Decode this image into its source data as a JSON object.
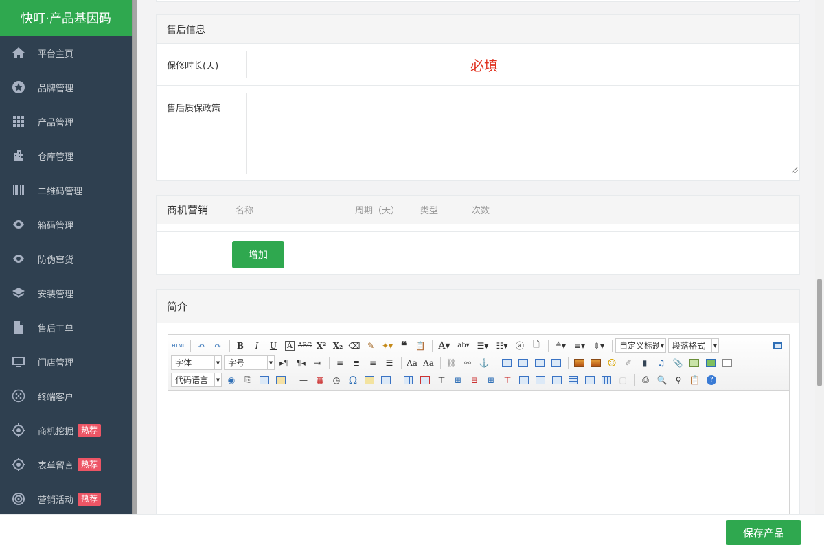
{
  "sidebar": {
    "brand": "快叮·产品基因码",
    "items": [
      {
        "label": "平台主页",
        "icon": "home-icon"
      },
      {
        "label": "品牌管理",
        "icon": "star-icon"
      },
      {
        "label": "产品管理",
        "icon": "grid-icon"
      },
      {
        "label": "仓库管理",
        "icon": "building-icon"
      },
      {
        "label": "二维码管理",
        "icon": "barcode-icon"
      },
      {
        "label": "箱码管理",
        "icon": "eye-icon"
      },
      {
        "label": "防伪窜货",
        "icon": "eye-icon"
      },
      {
        "label": "安装管理",
        "icon": "layers-icon"
      },
      {
        "label": "售后工单",
        "icon": "file-icon"
      },
      {
        "label": "门店管理",
        "icon": "monitor-icon"
      },
      {
        "label": "终端客户",
        "icon": "globe-icon"
      },
      {
        "label": "商机挖掘",
        "icon": "target-icon",
        "badge": "热荐"
      },
      {
        "label": "表单留言",
        "icon": "target-icon",
        "badge": "热荐"
      },
      {
        "label": "营销活动",
        "icon": "broadcast-icon",
        "badge": "热荐"
      }
    ]
  },
  "after_sales": {
    "title": "售后信息",
    "warranty_label": "保修时长(天)",
    "warranty_value": "",
    "required_text": "必填",
    "policy_label": "售后质保政策",
    "policy_value": ""
  },
  "marketing": {
    "title": "商机营销",
    "columns": [
      "名称",
      "周期（天）",
      "类型",
      "次数"
    ],
    "add_label": "增加"
  },
  "intro": {
    "title": "简介",
    "toolbar": {
      "custom_title": "自定义标题",
      "paragraph": "段落格式",
      "font": "字体",
      "font_size": "字号",
      "code_lang": "代码语言",
      "html_label": "HTML"
    }
  },
  "footer": {
    "save_label": "保存产品"
  },
  "colors": {
    "brand_green": "#2fa84f",
    "sidebar_bg": "#2f4050",
    "badge_red": "#ed5565",
    "required_red": "#e0301e"
  }
}
